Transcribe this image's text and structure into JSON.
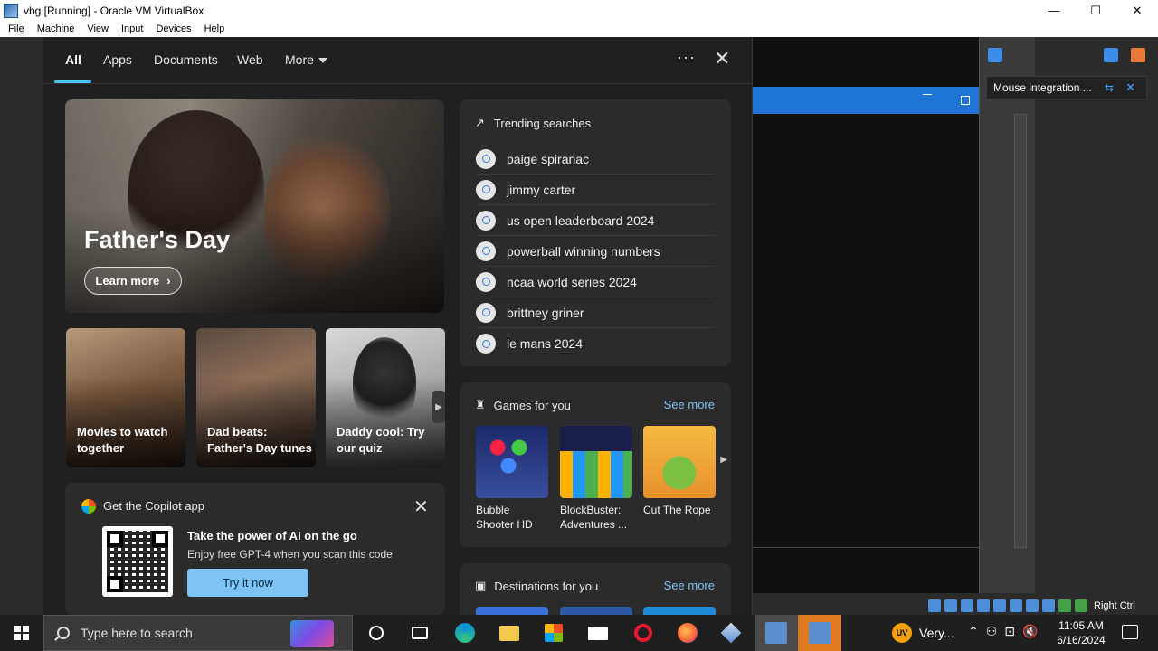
{
  "window": {
    "title": "vbg [Running] - Oracle VM VirtualBox",
    "minimize": "—",
    "maximize": "☐",
    "close": "✕"
  },
  "menu": [
    "File",
    "Machine",
    "View",
    "Input",
    "Devices",
    "Help"
  ],
  "notification": {
    "text": "Mouse integration ..."
  },
  "vb_status": {
    "host_key": "Right Ctrl"
  },
  "flyout": {
    "tabs": [
      "All",
      "Apps",
      "Documents",
      "Web",
      "More"
    ],
    "active_tab": "All",
    "more_options": "···",
    "close": "✕"
  },
  "hero": {
    "title": "Father's Day",
    "button": "Learn more",
    "chevron": "›"
  },
  "cards": [
    {
      "label": "Movies to watch together"
    },
    {
      "label": "Dad beats: Father's Day tunes"
    },
    {
      "label": "Daddy cool: Try our quiz"
    }
  ],
  "cards_next": "▶",
  "copilot": {
    "title": "Get the Copilot app",
    "heading": "Take the power of AI on the go",
    "subtext": "Enjoy free GPT-4 when you scan this code",
    "button": "Try it now",
    "close": "✕"
  },
  "trending": {
    "title": "Trending searches",
    "icon": "↗",
    "items": [
      "paige spiranac",
      "jimmy carter",
      "us open leaderboard 2024",
      "powerball winning numbers",
      "ncaa world series 2024",
      "brittney griner",
      "le mans 2024"
    ]
  },
  "games": {
    "title": "Games for you",
    "icon": "♜",
    "see_more": "See more",
    "items": [
      {
        "name": "Bubble Shooter HD"
      },
      {
        "name": "BlockBuster: Adventures ..."
      },
      {
        "name": "Cut The Rope"
      }
    ],
    "next": "▶"
  },
  "destinations": {
    "title": "Destinations for you",
    "icon": "▣",
    "see_more": "See more"
  },
  "taskbar": {
    "search_placeholder": "Type here to search",
    "weather_text": "Very...",
    "weather_badge": "UV",
    "time": "11:05 AM",
    "date": "6/16/2024"
  },
  "colors": {
    "accent": "#4cc2ff",
    "link": "#7cc4f4",
    "button": "#7cc4f4",
    "vm_blue": "#1e74d3",
    "active_orange": "#e07a22"
  }
}
